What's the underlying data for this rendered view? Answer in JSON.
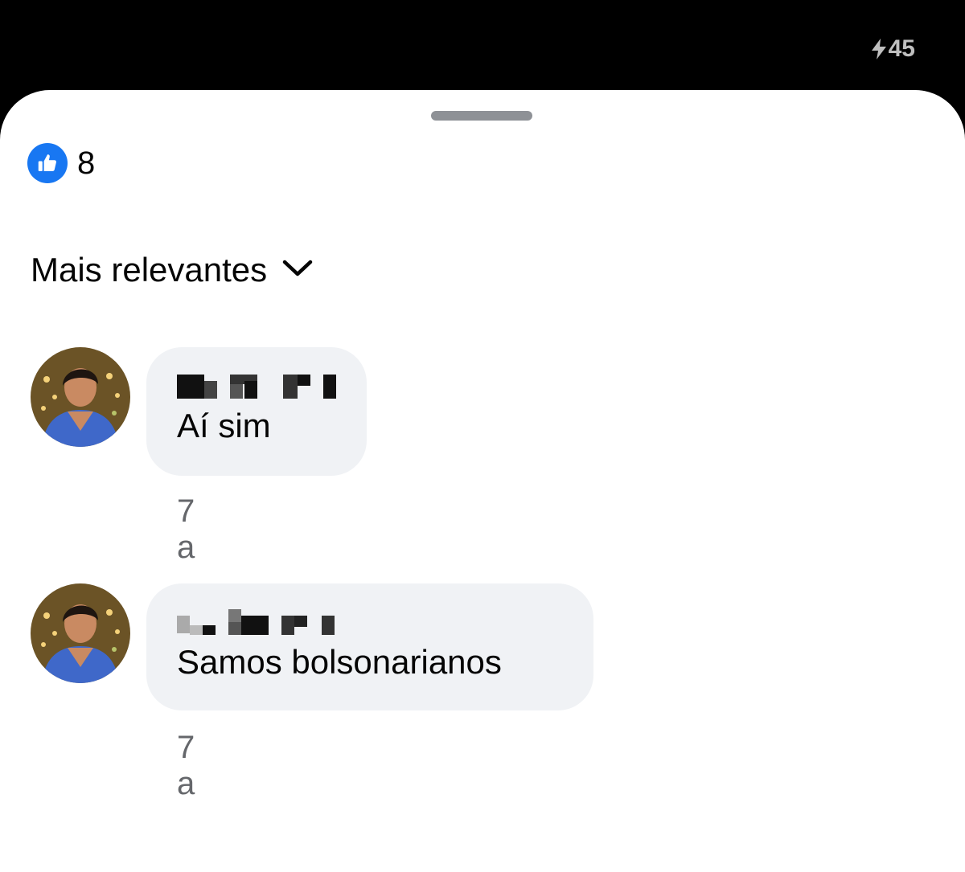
{
  "status_bar": {
    "battery_level": "45",
    "charging_icon": "lightning-bolt-icon"
  },
  "reactions": {
    "icon": "thumbs-up-icon",
    "count": "8"
  },
  "sort": {
    "label": "Mais relevantes",
    "icon": "chevron-down-icon"
  },
  "comments": [
    {
      "author": "",
      "author_pixelated": true,
      "text": "Aí sim",
      "time": "7 a"
    },
    {
      "author": "",
      "author_pixelated": true,
      "text": "Samos bolsonarianos",
      "time": "7 a"
    }
  ],
  "colors": {
    "accent": "#1877f2",
    "bubble": "#f0f2f5",
    "secondary_text": "#65676b"
  }
}
